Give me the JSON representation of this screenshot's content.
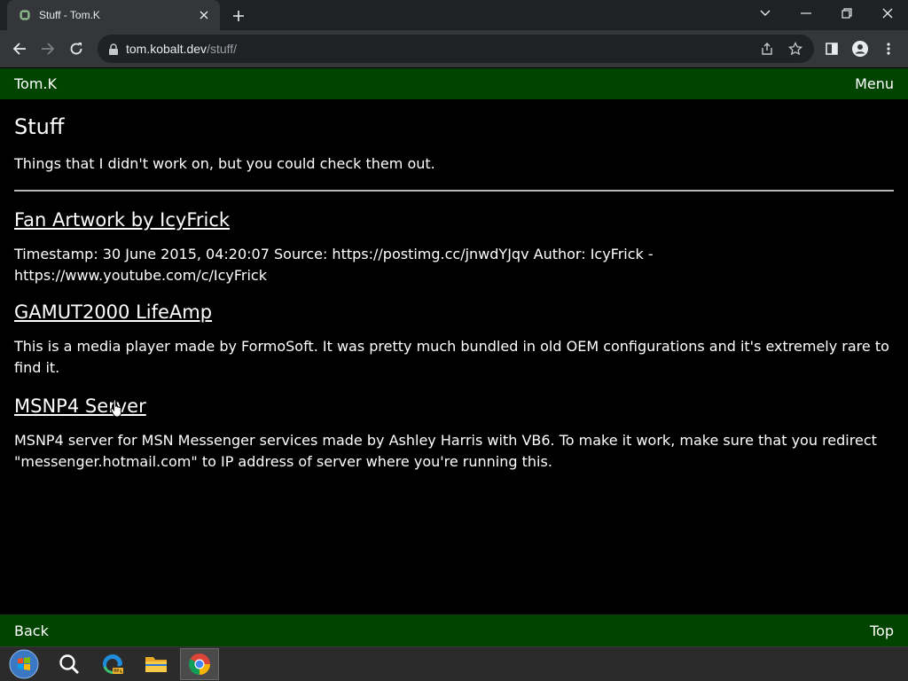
{
  "browser": {
    "tab_title": "Stuff - Tom.K",
    "url_host": "tom.kobalt.dev",
    "url_path": "/stuff/"
  },
  "header": {
    "brand": "Tom.K",
    "menu": "Menu"
  },
  "page": {
    "title": "Stuff",
    "description": "Things that I didn't work on, but you could check them out."
  },
  "entries": [
    {
      "title": "Fan Artwork by IcyFrick",
      "text": "Timestamp: 30 June 2015, 04:20:07 Source: https://postimg.cc/jnwdYJqv Author: IcyFrick - https://www.youtube.com/c/IcyFrick"
    },
    {
      "title": "GAMUT2000 LifeAmp",
      "text": "This is a media player made by FormoSoft. It was pretty much bundled in old OEM configurations and it's extremely rare to find it."
    },
    {
      "title": "MSNP4 Server",
      "text": "MSNP4 server for MSN Messenger services made by Ashley Harris with VB6. To make it work, make sure that you redirect \"messenger.hotmail.com\" to IP address of server where you're running this."
    }
  ],
  "footer": {
    "back": "Back",
    "top": "Top"
  },
  "colors": {
    "header_bg": "#004400",
    "page_bg": "#000000",
    "text": "#ffffff"
  }
}
